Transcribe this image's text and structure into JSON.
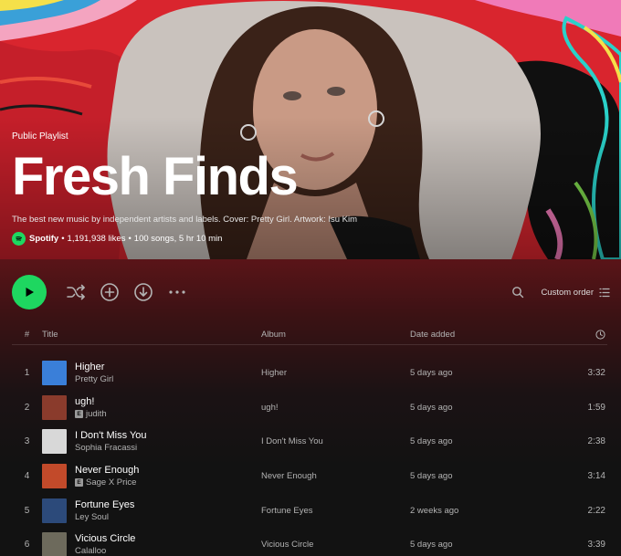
{
  "playlist": {
    "type_label": "Public Playlist",
    "title": "Fresh Finds",
    "description": "The best new music by independent artists and labels. Cover: Pretty Girl. Artwork: Isu Kim",
    "owner": "Spotify",
    "likes": "1,191,938 likes",
    "stats": "100 songs, 5 hr 10 min",
    "separator": "•"
  },
  "actions": {
    "play_icon": "play-icon",
    "shuffle_icon": "shuffle-icon",
    "add_icon": "add-circle-icon",
    "download_icon": "download-icon",
    "more_icon": "more-icon",
    "search_icon": "search-icon",
    "sort_label": "Custom order"
  },
  "table": {
    "headers": {
      "number": "#",
      "title": "Title",
      "album": "Album",
      "date_added": "Date added",
      "duration_icon": "clock-icon"
    },
    "tracks": [
      {
        "number": "1",
        "title": "Higher",
        "artist": "Pretty Girl",
        "explicit": false,
        "album": "Higher",
        "date_added": "5 days ago",
        "duration": "3:32",
        "cover_color": "#3a7fd9"
      },
      {
        "number": "2",
        "title": "ugh!",
        "artist": "judith",
        "explicit": true,
        "album": "ugh!",
        "date_added": "5 days ago",
        "duration": "1:59",
        "cover_color": "#8a3b2c"
      },
      {
        "number": "3",
        "title": "I Don't Miss You",
        "artist": "Sophia Fracassi",
        "explicit": false,
        "album": "I Don't Miss You",
        "date_added": "5 days ago",
        "duration": "2:38",
        "cover_color": "#d8d8d8"
      },
      {
        "number": "4",
        "title": "Never Enough",
        "artist": "Sage X Price",
        "explicit": true,
        "album": "Never Enough",
        "date_added": "5 days ago",
        "duration": "3:14",
        "cover_color": "#c24a2a"
      },
      {
        "number": "5",
        "title": "Fortune Eyes",
        "artist": "Ley Soul",
        "explicit": false,
        "album": "Fortune Eyes",
        "date_added": "2 weeks ago",
        "duration": "2:22",
        "cover_color": "#2c4a7a"
      },
      {
        "number": "6",
        "title": "Vicious Circle",
        "artist": "Calalloo",
        "explicit": false,
        "album": "Vicious Circle",
        "date_added": "5 days ago",
        "duration": "3:39",
        "cover_color": "#6d6a5c"
      }
    ],
    "explicit_badge": "E"
  },
  "colors": {
    "accent": "#1ed760",
    "hero_red": "#d9252e",
    "header_gradient_top": "#5a1418"
  }
}
